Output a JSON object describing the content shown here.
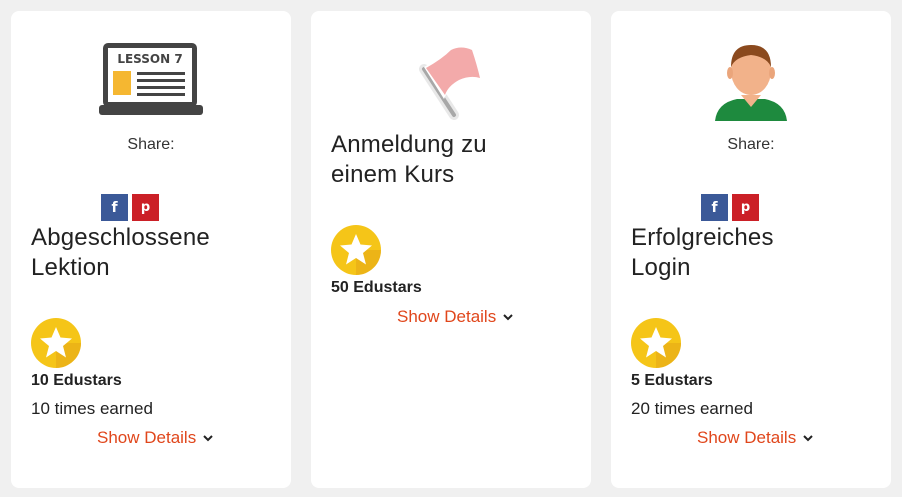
{
  "cards": [
    {
      "icon": "lesson-laptop-icon",
      "icon_text": "LESSON 7",
      "share_label": "Share:",
      "share_buttons": [
        "f",
        "p"
      ],
      "title_line1": "Abgeschlossene",
      "title_line2": "Lektion",
      "points": "10 Edustars",
      "earned": "10 times earned",
      "details": "Show Details"
    },
    {
      "icon": "flag-icon",
      "title_line1": "Anmeldung zu",
      "title_line2": "einem Kurs",
      "points": "50 Edustars",
      "details": "Show Details"
    },
    {
      "icon": "user-avatar-icon",
      "share_label": "Share:",
      "share_buttons": [
        "f",
        "p"
      ],
      "title_line1": "Erfolgreiches",
      "title_line2": "Login",
      "points": "5 Edustars",
      "earned": "20 times earned",
      "details": "Show Details"
    }
  ],
  "colors": {
    "accent": "#e0461b",
    "facebook": "#3b5998",
    "pinterest": "#cb2027",
    "star_gold": "#f5c518"
  }
}
